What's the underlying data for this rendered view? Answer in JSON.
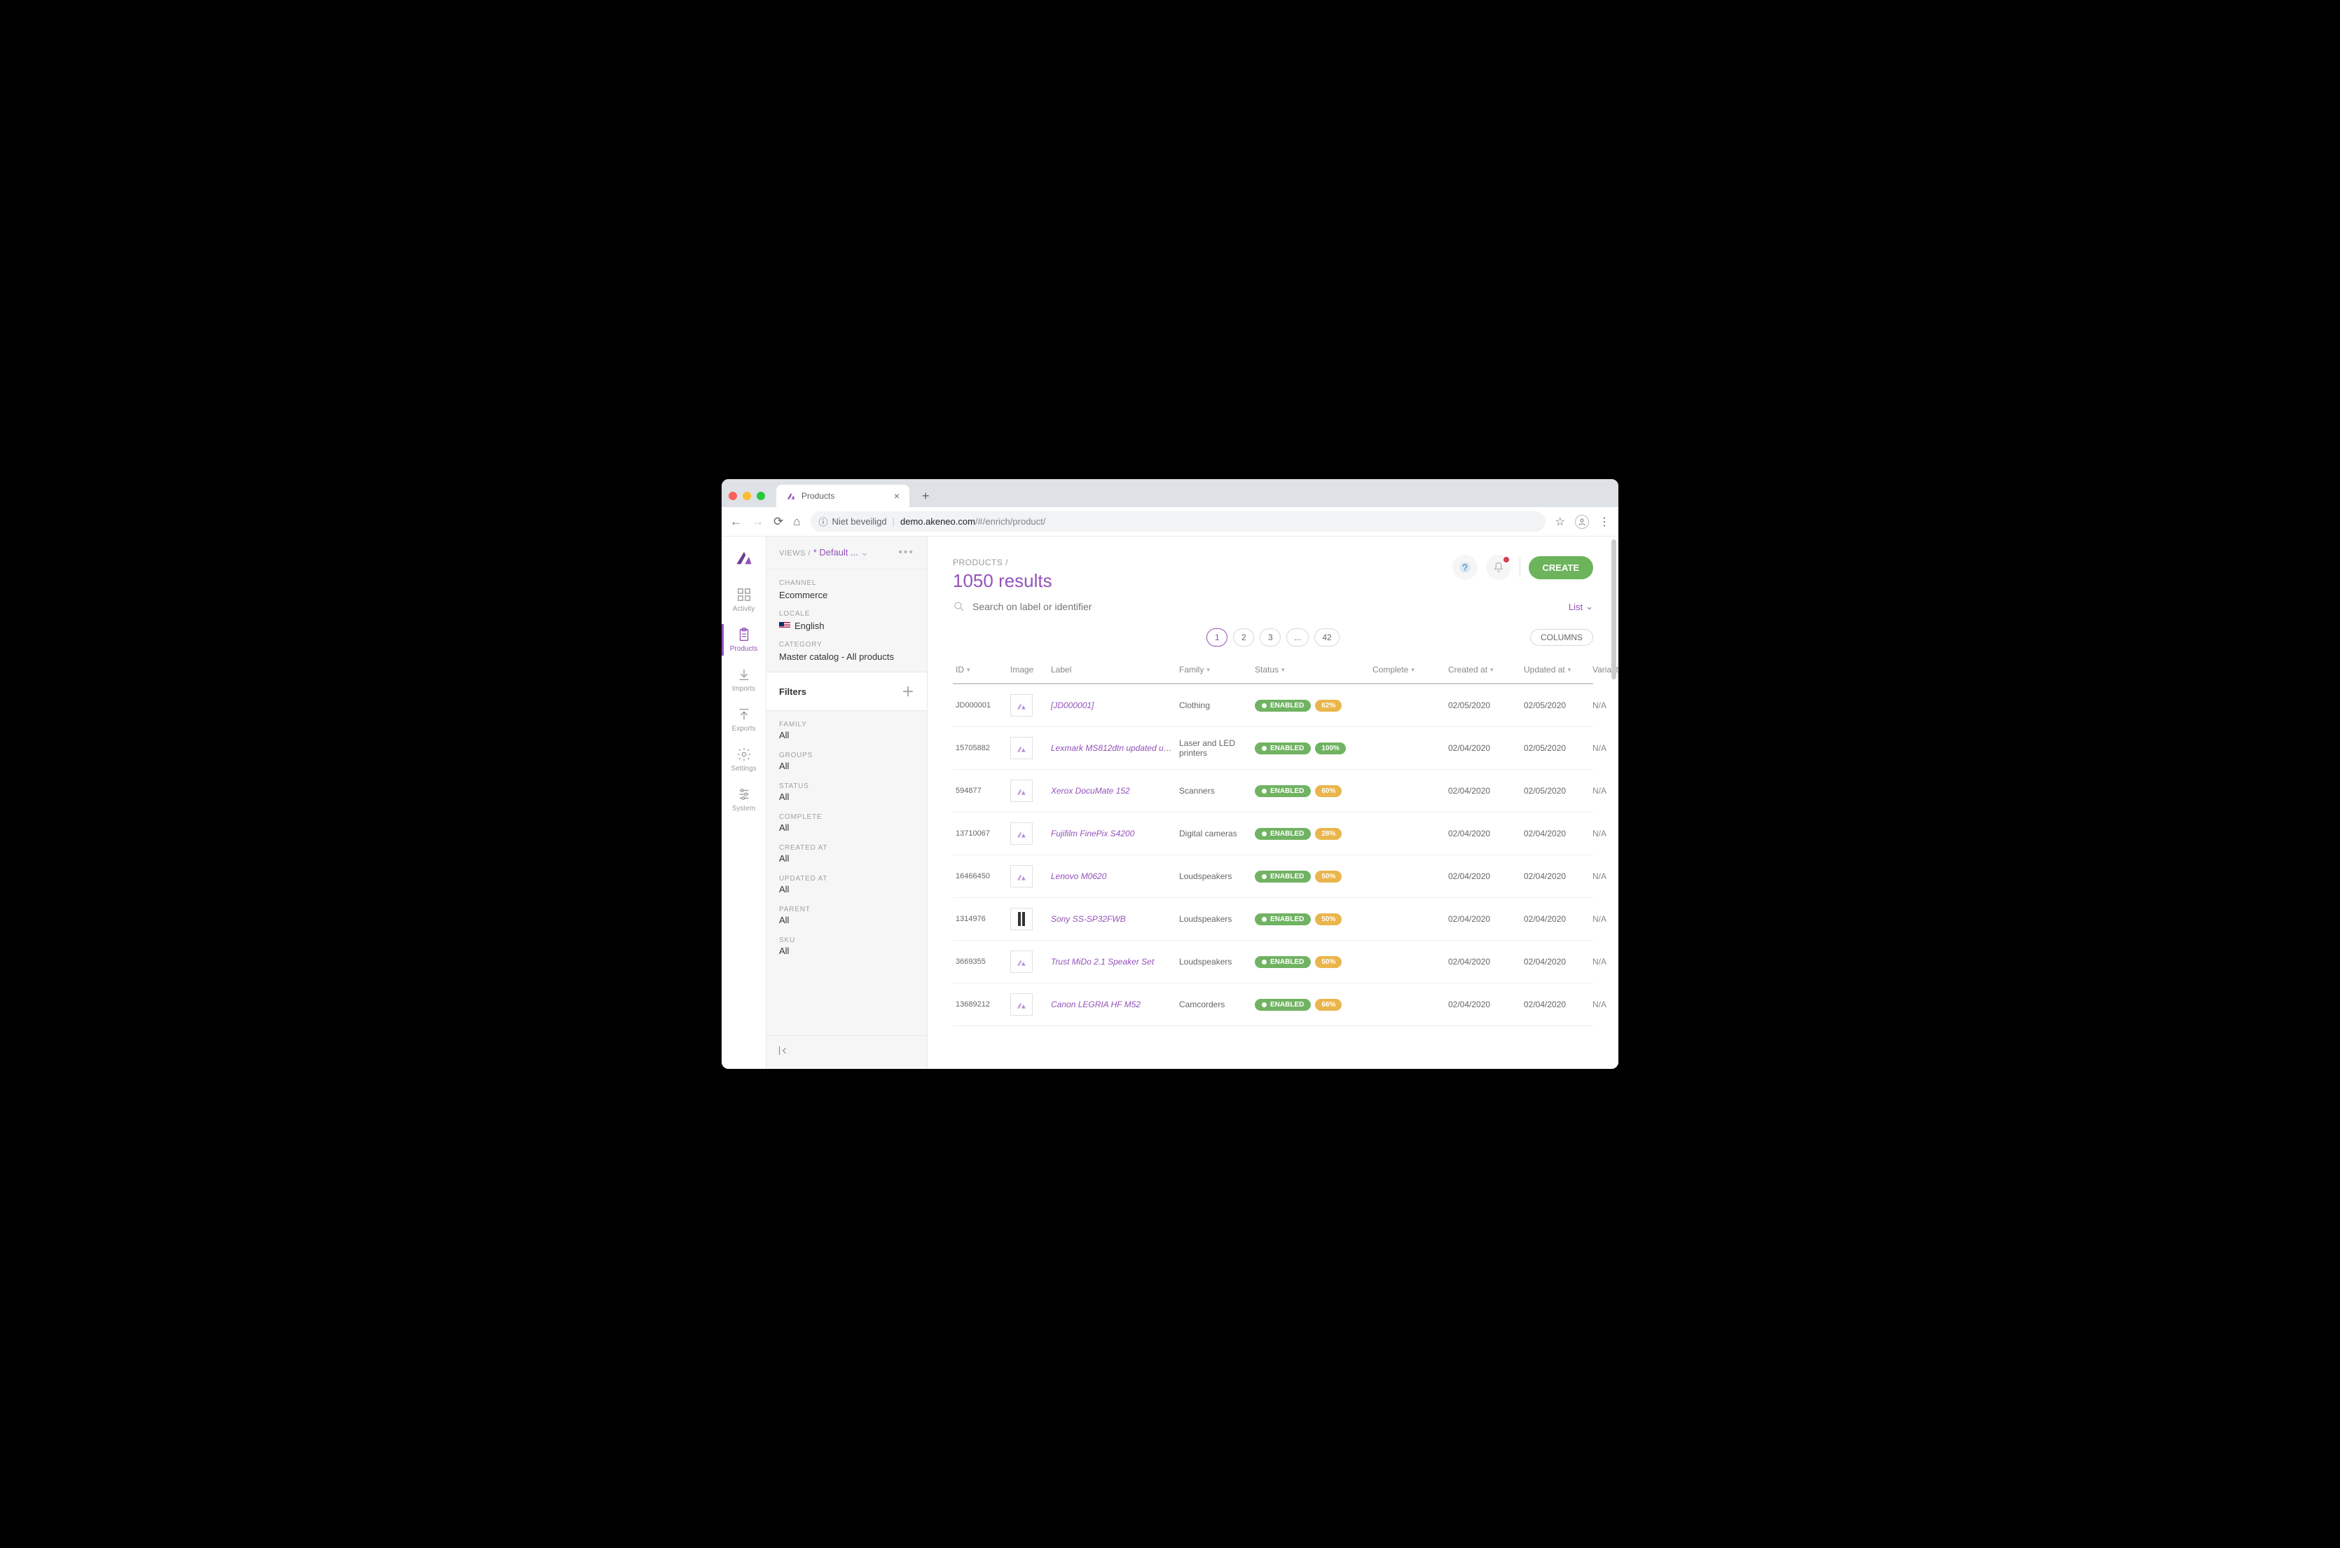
{
  "browser": {
    "tab_title": "Products",
    "url_security_label": "Niet beveiligd",
    "url_host": "demo.akeneo.com",
    "url_path": "/#/enrich/product/"
  },
  "nav": {
    "items": [
      {
        "label": "Activity"
      },
      {
        "label": "Products"
      },
      {
        "label": "Imports"
      },
      {
        "label": "Exports"
      },
      {
        "label": "Settings"
      },
      {
        "label": "System"
      }
    ]
  },
  "views": {
    "prefix": "VIEWS /",
    "name": "* Default ..."
  },
  "context": {
    "channel_label": "CHANNEL",
    "channel_value": "Ecommerce",
    "locale_label": "LOCALE",
    "locale_value": "English",
    "category_label": "CATEGORY",
    "category_value": "Master catalog - All products"
  },
  "filters_header": "Filters",
  "filters": [
    {
      "label": "FAMILY",
      "value": "All"
    },
    {
      "label": "GROUPS",
      "value": "All"
    },
    {
      "label": "STATUS",
      "value": "All"
    },
    {
      "label": "COMPLETE",
      "value": "All"
    },
    {
      "label": "CREATED AT",
      "value": "All"
    },
    {
      "label": "UPDATED AT",
      "value": "All"
    },
    {
      "label": "PARENT",
      "value": "All"
    },
    {
      "label": "SKU",
      "value": "All"
    }
  ],
  "header": {
    "breadcrumb": "PRODUCTS /",
    "results": "1050 results",
    "create_label": "CREATE"
  },
  "search": {
    "placeholder": "Search on label or identifier",
    "view_toggle": "List"
  },
  "pagination": {
    "pages": [
      "1",
      "2",
      "3",
      "...",
      "42"
    ],
    "active_index": 0,
    "columns_label": "COLUMNS"
  },
  "columns": {
    "id": "ID",
    "image": "Image",
    "label": "Label",
    "family": "Family",
    "status": "Status",
    "complete": "Complete",
    "created": "Created at",
    "updated": "Updated at",
    "variant": "Variant products"
  },
  "rows": [
    {
      "id": "JD000001",
      "label": "[JD000001]",
      "family": "Clothing",
      "status": "ENABLED",
      "complete": "62%",
      "cclass": "pct-yellow",
      "created": "02/05/2020",
      "updated": "02/05/2020",
      "variant": "N/A",
      "thumb": "logo"
    },
    {
      "id": "15705882",
      "label": "Lexmark MS812dtn updated up...",
      "family": "Laser and LED printers",
      "status": "ENABLED",
      "complete": "100%",
      "cclass": "pct-green",
      "created": "02/04/2020",
      "updated": "02/05/2020",
      "variant": "N/A",
      "thumb": "logo"
    },
    {
      "id": "594877",
      "label": "Xerox DocuMate 152",
      "family": "Scanners",
      "status": "ENABLED",
      "complete": "60%",
      "cclass": "pct-yellow",
      "created": "02/04/2020",
      "updated": "02/05/2020",
      "variant": "N/A",
      "thumb": "logo"
    },
    {
      "id": "13710067",
      "label": "Fujifilm FinePix S4200",
      "family": "Digital cameras",
      "status": "ENABLED",
      "complete": "28%",
      "cclass": "pct-yellow",
      "created": "02/04/2020",
      "updated": "02/04/2020",
      "variant": "N/A",
      "thumb": "logo"
    },
    {
      "id": "16466450",
      "label": "Lenovo M0620",
      "family": "Loudspeakers",
      "status": "ENABLED",
      "complete": "50%",
      "cclass": "pct-yellow",
      "created": "02/04/2020",
      "updated": "02/04/2020",
      "variant": "N/A",
      "thumb": "logo"
    },
    {
      "id": "1314976",
      "label": "Sony SS-SP32FWB",
      "family": "Loudspeakers",
      "status": "ENABLED",
      "complete": "50%",
      "cclass": "pct-yellow",
      "created": "02/04/2020",
      "updated": "02/04/2020",
      "variant": "N/A",
      "thumb": "speaker"
    },
    {
      "id": "3669355",
      "label": "Trust MiDo 2.1 Speaker Set",
      "family": "Loudspeakers",
      "status": "ENABLED",
      "complete": "50%",
      "cclass": "pct-yellow",
      "created": "02/04/2020",
      "updated": "02/04/2020",
      "variant": "N/A",
      "thumb": "logo"
    },
    {
      "id": "13689212",
      "label": "Canon LEGRIA HF M52",
      "family": "Camcorders",
      "status": "ENABLED",
      "complete": "66%",
      "cclass": "pct-yellow",
      "created": "02/04/2020",
      "updated": "02/04/2020",
      "variant": "N/A",
      "thumb": "logo"
    }
  ]
}
